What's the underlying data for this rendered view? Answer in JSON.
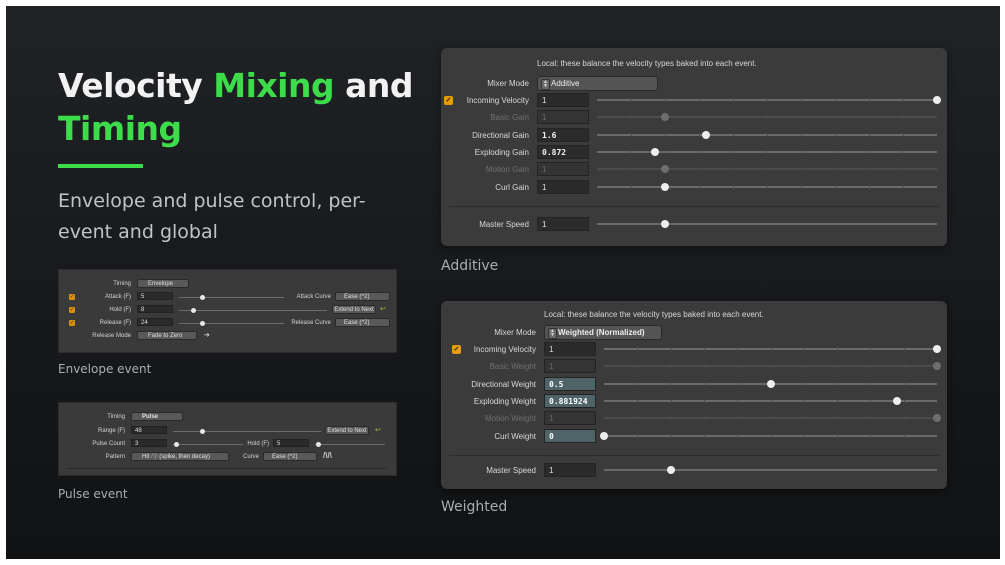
{
  "slide": {
    "title_part1": "Velocity ",
    "title_hl1": "Mixing",
    "title_part2": " and",
    "title_hl2": "Timing",
    "subtitle": "Envelope and pulse control, per-event and global",
    "colors": {
      "accent": "#3ddc4a",
      "background": "#1b1d20",
      "panel": "#3b3b3b",
      "checkbox": "#e69a12"
    }
  },
  "envelope_panel": {
    "caption": "Envelope event",
    "timing_label": "Timing",
    "timing_value": "Envelope",
    "attack_label": "Attack (F)",
    "attack_value": "5",
    "attack_slider": 0.22,
    "attack_curve_label": "Attack Curve",
    "attack_curve_value": "Ease (^2)",
    "hold_label": "Hold (F)",
    "hold_value": "8",
    "hold_slider": 0.1,
    "extend_button": "Extend to Next",
    "release_label": "Release (F)",
    "release_value": "24",
    "release_slider": 0.22,
    "release_curve_label": "Release Curve",
    "release_curve_value": "Ease (^2)",
    "release_mode_label": "Release Mode",
    "release_mode_value": "Fade to Zero"
  },
  "pulse_panel": {
    "caption": "Pulse event",
    "timing_label": "Timing",
    "timing_value": "Pulse",
    "range_label": "Range (F)",
    "range_value": "48",
    "range_slider": 0.2,
    "extend_button": "Extend to Next",
    "pulse_count_label": "Pulse Count",
    "pulse_count_value": "3",
    "pulse_count_slider": 0.05,
    "hold_label": "Hold (F)",
    "hold_value": "5",
    "hold_slider": 0.05,
    "pattern_label": "Pattern",
    "pattern_value": "Hit",
    "pattern_desc": "(spike, then decay)",
    "curve_label": "Curve",
    "curve_value": "Ease (^2)"
  },
  "additive_panel": {
    "caption": "Additive",
    "note": "Local: these balance the velocity types baked into each event.",
    "mixer_mode_label": "Mixer Mode",
    "mixer_mode_value": "Additive",
    "rows": [
      {
        "label": "Incoming Velocity",
        "value": "1",
        "slider": 1.0,
        "enabled": true,
        "checked": true
      },
      {
        "label": "Basic Gain",
        "value": "1",
        "slider": 0.2,
        "enabled": false
      },
      {
        "label": "Directional Gain",
        "value": "1.6",
        "slider": 0.32,
        "enabled": true
      },
      {
        "label": "Exploding Gain",
        "value": "0.872",
        "slider": 0.17,
        "enabled": true
      },
      {
        "label": "Motion Gain",
        "value": "1",
        "slider": 0.2,
        "enabled": false
      },
      {
        "label": "Curl Gain",
        "value": "1",
        "slider": 0.2,
        "enabled": true
      }
    ],
    "master_speed_label": "Master Speed",
    "master_speed_value": "1",
    "master_speed_slider": 0.2
  },
  "weighted_panel": {
    "caption": "Weighted",
    "note": "Local: these balance the velocity types baked into each event.",
    "mixer_mode_label": "Mixer Mode",
    "mixer_mode_value": "Weighted (Normalized)",
    "rows": [
      {
        "label": "Incoming Velocity",
        "value": "1",
        "slider": 1.0,
        "enabled": true,
        "checked": true
      },
      {
        "label": "Basic Weight",
        "value": "1",
        "slider": 1.0,
        "enabled": false
      },
      {
        "label": "Directional Weight",
        "value": "0.5",
        "slider": 0.5,
        "enabled": true
      },
      {
        "label": "Exploding Weight",
        "value": "0.881924",
        "slider": 0.88,
        "enabled": true
      },
      {
        "label": "Motion Weight",
        "value": "1",
        "slider": 1.0,
        "enabled": false
      },
      {
        "label": "Curl Weight",
        "value": "0",
        "slider": 0.0,
        "enabled": true
      }
    ],
    "master_speed_label": "Master Speed",
    "master_speed_value": "1",
    "master_speed_slider": 0.2
  }
}
